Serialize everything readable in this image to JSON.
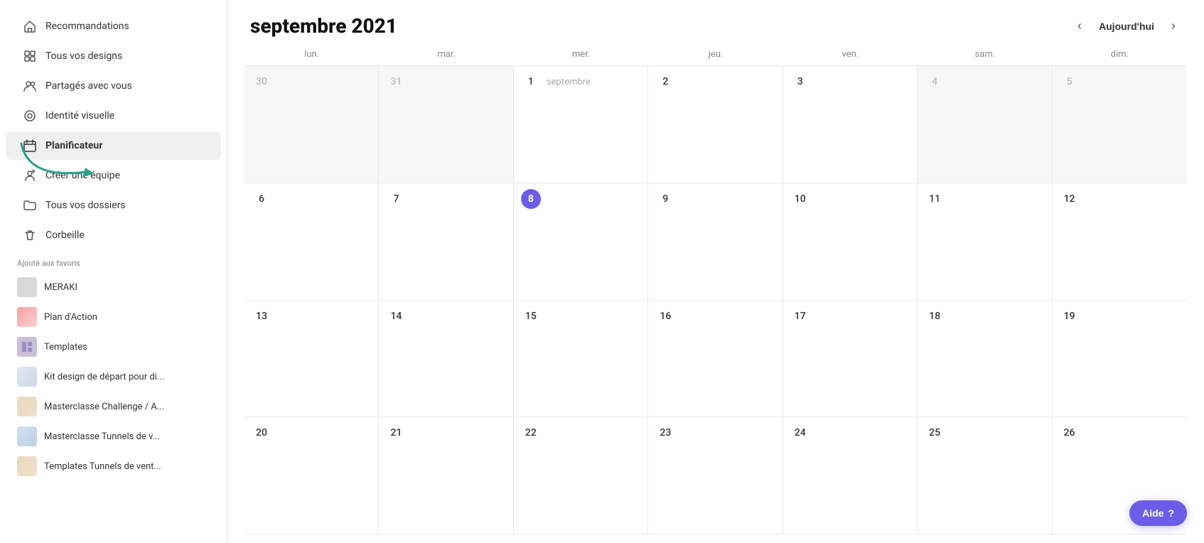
{
  "sidebar": {
    "nav_items": [
      {
        "id": "recommandations",
        "label": "Recommandations",
        "icon": "home"
      },
      {
        "id": "tous-designs",
        "label": "Tous vos designs",
        "icon": "grid"
      },
      {
        "id": "partages",
        "label": "Partagés avec vous",
        "icon": "users"
      },
      {
        "id": "identite",
        "label": "Identité visuelle",
        "icon": "brand"
      },
      {
        "id": "planificateur",
        "label": "Planificateur",
        "icon": "calendar",
        "active": true
      },
      {
        "id": "creer-equipe",
        "label": "Créer une équipe",
        "icon": "team"
      },
      {
        "id": "tous-dossiers",
        "label": "Tous vos dossiers",
        "icon": "folder"
      },
      {
        "id": "corbeille",
        "label": "Corbeille",
        "icon": "trash"
      }
    ],
    "section_label": "Ajouté aux favoris",
    "fav_items": [
      {
        "id": "meraki",
        "label": "MERAKI",
        "thumb": "meraki"
      },
      {
        "id": "plan-action",
        "label": "Plan d'Action",
        "thumb": "plan"
      },
      {
        "id": "templates",
        "label": "Templates",
        "thumb": "templates"
      },
      {
        "id": "kit-design",
        "label": "Kit design de départ pour di...",
        "thumb": "kit"
      },
      {
        "id": "masterclasse1",
        "label": "Masterclasse Challenge / A...",
        "thumb": "masterclasse1"
      },
      {
        "id": "masterclasse2",
        "label": "Masterclasse Tunnels de v...",
        "thumb": "masterclasse2"
      },
      {
        "id": "masterclasse3",
        "label": "Templates Tunnels de vent...",
        "thumb": "masterclasse3"
      }
    ]
  },
  "calendar": {
    "title": "septembre 2021",
    "nav": {
      "prev_label": "‹",
      "today_label": "Aujourd'hui",
      "next_label": "›"
    },
    "day_names": [
      "lun.",
      "mar.",
      "mer.",
      "jeu.",
      "ven.",
      "sam.",
      "dim."
    ],
    "weeks": [
      {
        "days": [
          {
            "num": "30",
            "outside": true
          },
          {
            "num": "31",
            "outside": true
          },
          {
            "num": "1",
            "month_label": "septembre"
          },
          {
            "num": "2"
          },
          {
            "num": "3"
          },
          {
            "num": "4"
          },
          {
            "num": "5"
          }
        ]
      },
      {
        "days": [
          {
            "num": "6"
          },
          {
            "num": "7"
          },
          {
            "num": "8",
            "today": true
          },
          {
            "num": "9"
          },
          {
            "num": "10"
          },
          {
            "num": "11"
          },
          {
            "num": "12"
          }
        ]
      },
      {
        "days": [
          {
            "num": "13"
          },
          {
            "num": "14"
          },
          {
            "num": "15"
          },
          {
            "num": "16"
          },
          {
            "num": "17"
          },
          {
            "num": "18"
          },
          {
            "num": "19"
          }
        ]
      },
      {
        "days": [
          {
            "num": "20"
          },
          {
            "num": "21"
          },
          {
            "num": "22"
          },
          {
            "num": "23"
          },
          {
            "num": "24"
          },
          {
            "num": "25"
          },
          {
            "num": "26"
          }
        ]
      }
    ]
  },
  "help_button": {
    "label": "Aide",
    "icon": "?"
  }
}
